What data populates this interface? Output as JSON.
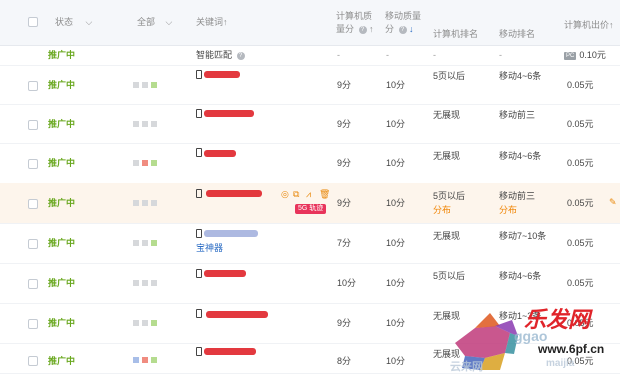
{
  "header": {
    "status": "状态",
    "all": "全部",
    "keyword": "关键词",
    "pc_quality_1": "计算机质",
    "pc_quality_2": "量分",
    "mobile_quality_1": "移动质量",
    "mobile_quality_2": "分",
    "pc_rank": "计算机排名",
    "mobile_rank": "移动排名",
    "pc_bid": "计算机出价",
    "sort_arrow": "↑",
    "sort_arrow_active": "↓",
    "chevron": "⌵",
    "help": "?"
  },
  "smart_row": {
    "status": "推广中",
    "keyword": "智能匹配",
    "pc_quality": "-",
    "mobile_quality": "-",
    "pc_rank": "-",
    "mobile_rank": "-",
    "pc_badge": "PC",
    "bid": "0.10元"
  },
  "rows": [
    {
      "status": "推广中",
      "pc_quality": "9分",
      "mobile_quality": "10分",
      "pc_rank": "5页以后",
      "mobile_rank": "移动4~6条",
      "bid": "0.05元"
    },
    {
      "status": "推广中",
      "pc_quality": "9分",
      "mobile_quality": "10分",
      "pc_rank": "无展现",
      "mobile_rank": "移动前三",
      "bid": "0.05元"
    },
    {
      "status": "推广中",
      "pc_quality": "9分",
      "mobile_quality": "10分",
      "pc_rank": "无展现",
      "mobile_rank": "移动4~6条",
      "bid": "0.05元"
    },
    {
      "status": "推广中",
      "pc_quality": "9分",
      "mobile_quality": "10分",
      "pc_rank": "5页以后",
      "pc_rank_link": "分布",
      "mobile_rank": "移动前三",
      "mobile_rank_link": "分布",
      "bid": "0.05元",
      "track": "轨迹",
      "track_prefix": "5G"
    },
    {
      "status": "推广中",
      "keyword_tail": "宝神器",
      "pc_quality": "7分",
      "mobile_quality": "10分",
      "pc_rank": "无展现",
      "mobile_rank": "移动7~10条",
      "bid": "0.05元"
    },
    {
      "status": "推广中",
      "pc_quality": "10分",
      "mobile_quality": "10分",
      "pc_rank": "5页以后",
      "mobile_rank": "移动4~6条",
      "bid": "0.05元"
    },
    {
      "status": "推广中",
      "pc_quality": "9分",
      "mobile_quality": "10分",
      "pc_rank": "无展现",
      "mobile_rank": "移动1~3条",
      "bid": "0.05元"
    },
    {
      "status": "推广中",
      "pc_quality": "8分",
      "mobile_quality": "10分",
      "pc_rank": "无展现",
      "mobile_rank": "",
      "bid": "0.05元"
    }
  ],
  "watermark": {
    "brand": "乐发网",
    "url": "www.6pf.cn",
    "sub": "ggao",
    "cn_small": "云来网",
    "cn_sub": "maijia"
  },
  "colors": {
    "status_green": "#6aa820",
    "link_orange": "#f08300",
    "track_red": "#e8345b",
    "watermark_red": "#e0242a"
  }
}
